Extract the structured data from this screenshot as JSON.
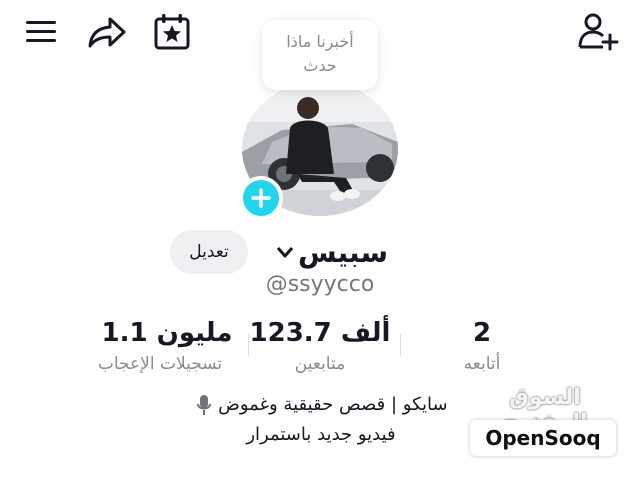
{
  "toolbar": {
    "menu_icon": "hamburger-menu-icon",
    "share_icon": "share-arrow-icon",
    "calendar_icon": "calendar-star-icon",
    "add_user_icon": "add-user-icon"
  },
  "profile": {
    "note": [
      "أخبرنا ماذا",
      "حدث"
    ],
    "display_name": "سبيس",
    "username": "@ssyycco",
    "edit_label": "تعديل",
    "accent": "#20d5ec"
  },
  "stats": [
    {
      "value": "1.1 مليون",
      "label": "تسجيلات الإعجاب"
    },
    {
      "value": "123.7 ألف",
      "label": "متابعين"
    },
    {
      "value": "2",
      "label": "أتابعه"
    }
  ],
  "bio": {
    "line1": "سايكو | قصص حقيقية وغموض",
    "line1_icon": "microphone-icon",
    "line2": "فيديو جديد باستمرار"
  },
  "watermark": {
    "arabic": "السوق المفتوح",
    "latin": "OpenSooq"
  }
}
